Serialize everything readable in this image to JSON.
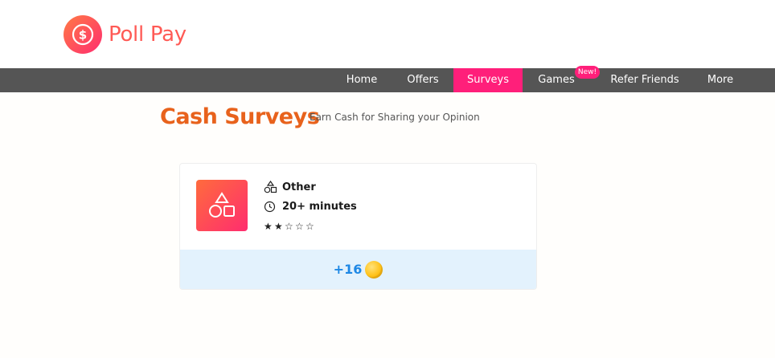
{
  "brand": {
    "name": "Poll Pay",
    "icon": "dollar-coin-icon"
  },
  "nav": {
    "items": [
      {
        "label": "Home",
        "active": false
      },
      {
        "label": "Offers",
        "active": false
      },
      {
        "label": "Surveys",
        "active": true
      },
      {
        "label": "Games",
        "active": false
      },
      {
        "label": "Refer Friends",
        "active": false
      },
      {
        "label": "More",
        "active": false
      }
    ],
    "games_badge": "New!"
  },
  "page": {
    "title": "Cash Surveys",
    "subtitle": "Earn Cash for Sharing your Opinion"
  },
  "survey": {
    "category": "Other",
    "category_icon": "shapes-icon",
    "duration": "20+ minutes",
    "duration_icon": "clock-icon",
    "rating": 2,
    "rating_max": 5,
    "reward": "+16",
    "reward_icon": "coin-icon"
  },
  "colors": {
    "brand_orange": "#e8621c",
    "accent_pink": "#ff1f7a",
    "nav_bg": "#555555",
    "reward_bg": "#e3f2fd",
    "reward_text": "#1e88e5"
  }
}
